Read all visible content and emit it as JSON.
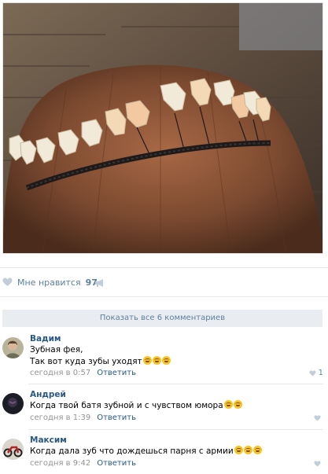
{
  "post": {
    "like_label": "Мне нравится",
    "like_count": "97",
    "show_all_comments": "Показать все 6 комментариев"
  },
  "comments": [
    {
      "author": "Вадим",
      "lines": [
        "Зубная фея,",
        "Так вот куда зубы уходят"
      ],
      "emoji_count": 3,
      "time": "сегодня в 0:57",
      "reply": "Ответить",
      "likes": "1"
    },
    {
      "author": "Андрей",
      "lines": [
        "Когда твой батя зубной и с чувством юмора"
      ],
      "emoji_count": 2,
      "time": "сегодня в 1:39",
      "reply": "Ответить",
      "likes": ""
    },
    {
      "author": "Максим",
      "lines": [
        "Когда дала зуб что дождешься парня с армии"
      ],
      "emoji_count": 3,
      "time": "сегодня в 9:42",
      "reply": "Ответить",
      "likes": ""
    }
  ],
  "icons": {
    "like": "heart-icon",
    "share": "megaphone-icon",
    "emoji": "laughing-emoji-icon"
  },
  "colors": {
    "link": "#2a5885",
    "muted": "#939393",
    "accent": "#5e7fa0",
    "show_all_bg": "#e9edf1"
  }
}
